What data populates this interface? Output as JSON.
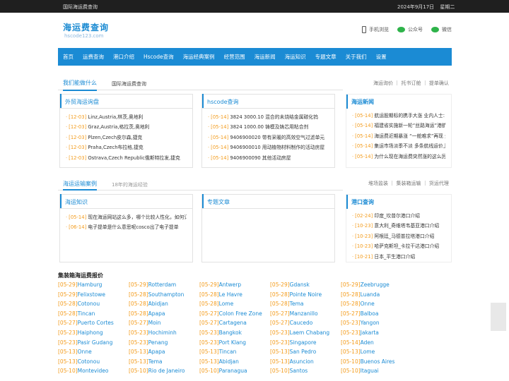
{
  "topbar": {
    "left": "国际海运费查询",
    "date": "2024年9月17日",
    "weekday": "星期二"
  },
  "logo": {
    "title": "海运费查询",
    "subtitle": "hscode123.com"
  },
  "header_links": [
    {
      "icon": "phone-icon",
      "label": "手机浏览"
    },
    {
      "icon": "wechat-icon",
      "label": "公众号"
    },
    {
      "icon": "wechat-icon",
      "label": "微信"
    }
  ],
  "nav": [
    "首页",
    "运费查询",
    "港口介绍",
    "Hscode查询",
    "海运经典案例",
    "经营范围",
    "海运新闻",
    "海运知识",
    "专题文章",
    "关于我们",
    "设置"
  ],
  "section1": {
    "tab_active": "我们能做什么",
    "tab_sub": "国际海运费查询",
    "right_links": "海运询价 ｜ 托书订舱 ｜ 提单确认"
  },
  "freight": {
    "title": "外贸海运询盘",
    "items": [
      {
        "date": "[12-03]",
        "text": "Linz,Austria,林茨,奥地利"
      },
      {
        "date": "[12-03]",
        "text": "Graz,Austria,格拉茨,奥地利"
      },
      {
        "date": "[12-03]",
        "text": "Plzen,Czech皮尔森,捷克"
      },
      {
        "date": "[12-03]",
        "text": "Praha,Czech布拉格,捷克"
      },
      {
        "date": "[12-03]",
        "text": "Ostrava,Czech Republic俄斯特拉发,捷克"
      }
    ]
  },
  "hscode": {
    "title": "hscode查询",
    "items": [
      {
        "date": "[05-14]",
        "text": "3824 3000.10 混合的未烧结金属碳化钨"
      },
      {
        "date": "[05-14]",
        "text": "3824 1000.00 铸模及铸芯用粘合剂"
      },
      {
        "date": "[05-14]",
        "text": "9406900020 带有采暖的高效空气过滤单元"
      },
      {
        "date": "[05-14]",
        "text": "9406900010 用动植物材料制作的活动房屋"
      },
      {
        "date": "[05-14]",
        "text": "9406900090 其他活动房屋"
      }
    ]
  },
  "news": {
    "title": "海运新闻",
    "items": [
      {
        "date": "[05-14]",
        "text": "航运股期标的携手大涨 业内人士:"
      },
      {
        "date": "[05-14]",
        "text": "福建省实施新一轮“丝路海运”港航"
      },
      {
        "date": "[05-14]",
        "text": "海运费近期暴涨 “一舱难求”再现 外"
      },
      {
        "date": "[05-14]",
        "text": "集运市场淡季不淡 多条航线运价上"
      },
      {
        "date": "[05-14]",
        "text": "为什么现在海运费突然涨的这么厉"
      }
    ]
  },
  "section2": {
    "tab_active": "海运运输案例",
    "tab_gray": "18年的海运经验",
    "right_links": "堆场监装 ｜ 集装箱运输 ｜ 货运代理"
  },
  "knowledge": {
    "title": "海运知识",
    "items": [
      {
        "date": "[05-14]",
        "text": "现在海运网站这么多，哪个比较人性化，如何订"
      },
      {
        "date": "[06-14]",
        "text": "电子提单是什么意思呢cosco出了电子提单"
      }
    ]
  },
  "topics": {
    "title": "专题文章",
    "items": []
  },
  "ports": {
    "title": "港口查询",
    "items": [
      {
        "date": "[02-24]",
        "text": "印度_坎普尔港口介绍"
      },
      {
        "date": "[10-23]",
        "text": "意大利_奇维塔韦基亚港口介绍"
      },
      {
        "date": "[10-23]",
        "text": "阿根廷_马德普拉塔港口介绍"
      },
      {
        "date": "[10-23]",
        "text": "哈萨克斯坦_卡拉干达港口介绍"
      },
      {
        "date": "[10-21]",
        "text": "日本_平生港口介绍"
      }
    ]
  },
  "rates": {
    "title": "集装箱海运费报价",
    "rows": [
      [
        [
          "[05-29]",
          "Hamburg"
        ],
        [
          "[05-29]",
          "Rotterdam"
        ],
        [
          "[05-29]",
          "Antwerp"
        ],
        [
          "[05-29]",
          "Gdansk"
        ],
        [
          "[05-29]",
          "Zeebrugge"
        ]
      ],
      [
        [
          "[05-29]",
          "Felixstowe"
        ],
        [
          "[05-28]",
          "Southampton"
        ],
        [
          "[05-28]",
          "Le Havre"
        ],
        [
          "[05-28]",
          "Pointe Noire"
        ],
        [
          "[05-28]",
          "Luanda"
        ]
      ],
      [
        [
          "[05-28]",
          "Cotonou"
        ],
        [
          "[05-28]",
          "Abidjan"
        ],
        [
          "[05-28]",
          "Lome"
        ],
        [
          "[05-28]",
          "Tema"
        ],
        [
          "[05-28]",
          "Onne"
        ]
      ],
      [
        [
          "[05-28]",
          "Tincan"
        ],
        [
          "[05-28]",
          "Apapa"
        ],
        [
          "[05-27]",
          "Colon Free Zone"
        ],
        [
          "[05-27]",
          "Manzanillo"
        ],
        [
          "[05-27]",
          "Balboa"
        ]
      ],
      [
        [
          "[05-27]",
          "Puerto Cortes"
        ],
        [
          "[05-27]",
          "Moin"
        ],
        [
          "[05-27]",
          "Cartagena"
        ],
        [
          "[05-27]",
          "Caucedo"
        ],
        [
          "[05-23]",
          "Yangon"
        ]
      ],
      [
        [
          "[05-23]",
          "Haiphong"
        ],
        [
          "[05-23]",
          "Hochiminh"
        ],
        [
          "[05-23]",
          "Bangkok"
        ],
        [
          "[05-23]",
          "Laem Chabang"
        ],
        [
          "[05-23]",
          "Jakarta"
        ]
      ],
      [
        [
          "[05-23]",
          "Pasir Gudang"
        ],
        [
          "[05-23]",
          "Penang"
        ],
        [
          "[05-23]",
          "Port Klang"
        ],
        [
          "[05-23]",
          "Singapore"
        ],
        [
          "[05-14]",
          "Aden"
        ]
      ],
      [
        [
          "[05-13]",
          "Onne"
        ],
        [
          "[05-13]",
          "Apapa"
        ],
        [
          "[05-13]",
          "Tincan"
        ],
        [
          "[05-13]",
          "San Pedro"
        ],
        [
          "[05-13]",
          "Lome"
        ]
      ],
      [
        [
          "[05-13]",
          "Cotonou"
        ],
        [
          "[05-13]",
          "Tema"
        ],
        [
          "[05-13]",
          "Abidjan"
        ],
        [
          "[05-13]",
          "Asuncion"
        ],
        [
          "[05-10]",
          "Buenos Aires"
        ]
      ],
      [
        [
          "[05-10]",
          "Montevideo"
        ],
        [
          "[05-10]",
          "Rio de Janeiro"
        ],
        [
          "[05-10]",
          "Paranagua"
        ],
        [
          "[05-10]",
          "Santos"
        ],
        [
          "[05-10]",
          "Itaguai"
        ]
      ]
    ]
  }
}
